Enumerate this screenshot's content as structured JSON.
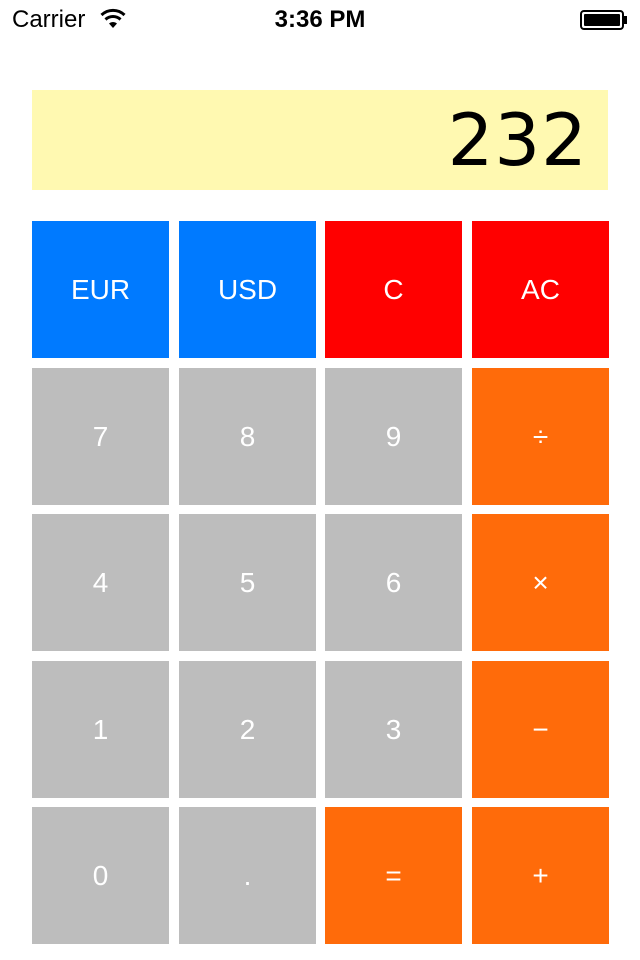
{
  "status_bar": {
    "carrier": "Carrier",
    "time": "3:36 PM",
    "wifi_icon": "wifi-icon",
    "battery_icon": "battery-icon"
  },
  "display": {
    "value": "232",
    "background": "#fff9b1"
  },
  "colors": {
    "currency": "#007aff",
    "clear": "#ff0000",
    "digit": "#bdbdbd",
    "operator": "#ff6b0a",
    "key_text": "#ffffff"
  },
  "keys": {
    "eur": "EUR",
    "usd": "USD",
    "clear": "C",
    "all_clear": "AC",
    "seven": "7",
    "eight": "8",
    "nine": "9",
    "divide": "÷",
    "four": "4",
    "five": "5",
    "six": "6",
    "multiply": "×",
    "one": "1",
    "two": "2",
    "three": "3",
    "minus": "−",
    "zero": "0",
    "decimal": ".",
    "equals": "=",
    "plus": "+"
  }
}
